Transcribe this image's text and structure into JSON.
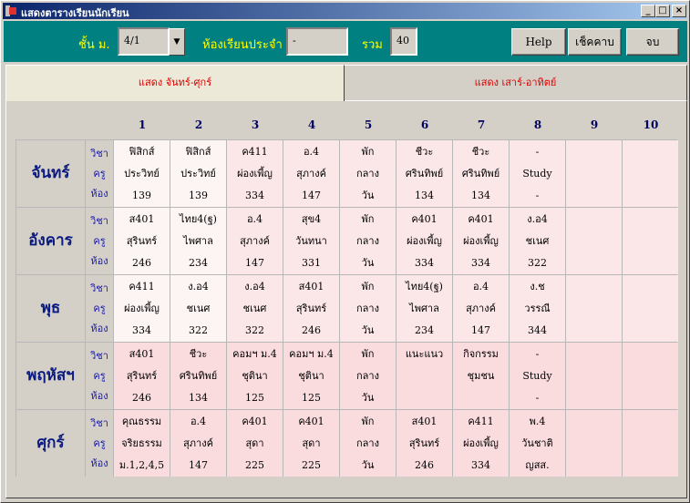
{
  "window": {
    "title": "แสดงตารางเรียนนักเรียน"
  },
  "toolbar": {
    "class_label": "ชั้น ม.",
    "class_value": "4/1",
    "homeroom_label": "ห้องเรียนประจำ",
    "homeroom_value": "-",
    "total_label": "รวม",
    "total_value": "40",
    "help_label": "Help",
    "check_label": "เช็คคาบ",
    "end_label": "จบ"
  },
  "tabs": [
    {
      "label": "แสดง จันทร์-ศุกร์",
      "active": true
    },
    {
      "label": "แสดง เสาร์-อาทิตย์",
      "active": false
    }
  ],
  "periods": [
    "1",
    "2",
    "3",
    "4",
    "5",
    "6",
    "7",
    "8",
    "9",
    "10"
  ],
  "row_labels": [
    "วิชา",
    "ครู",
    "ห้อง"
  ],
  "days": [
    {
      "name": "จันทร์",
      "cells": [
        [
          "ฟิสิกส์",
          "ประวิทย์",
          "139"
        ],
        [
          "ฟิสิกส์",
          "ประวิทย์",
          "139"
        ],
        [
          "ค411",
          "ผ่องเพี้ญ",
          "334"
        ],
        [
          "อ.4",
          "สุภางค์",
          "147"
        ],
        [
          "พัก",
          "กลาง",
          "วัน"
        ],
        [
          "ชีวะ",
          "ศรินทิพย์",
          "134"
        ],
        [
          "ชีวะ",
          "ศรินทิพย์",
          "134"
        ],
        [
          "-",
          "Study",
          "-"
        ],
        [
          "",
          "",
          ""
        ],
        [
          "",
          "",
          ""
        ]
      ]
    },
    {
      "name": "อังคาร",
      "cells": [
        [
          "ส401",
          "สุรินทร์",
          "246"
        ],
        [
          "ไทย4(ฐ)",
          "ไพศาล",
          "234"
        ],
        [
          "อ.4",
          "สุภางค์",
          "147"
        ],
        [
          "สุข4",
          "วันทนา",
          "331"
        ],
        [
          "พัก",
          "กลาง",
          "วัน"
        ],
        [
          "ค401",
          "ผ่องเพี้ญ",
          "334"
        ],
        [
          "ค401",
          "ผ่องเพี้ญ",
          "334"
        ],
        [
          "ง.อ4",
          "ชเนศ",
          "322"
        ],
        [
          "",
          "",
          ""
        ],
        [
          "",
          "",
          ""
        ]
      ]
    },
    {
      "name": "พุธ",
      "cells": [
        [
          "ค411",
          "ผ่องเพี้ญ",
          "334"
        ],
        [
          "ง.อ4",
          "ชเนศ",
          "322"
        ],
        [
          "ง.อ4",
          "ชเนศ",
          "322"
        ],
        [
          "ส401",
          "สุรินทร์",
          "246"
        ],
        [
          "พัก",
          "กลาง",
          "วัน"
        ],
        [
          "ไทย4(ฐ)",
          "ไพศาล",
          "234"
        ],
        [
          "อ.4",
          "สุภางค์",
          "147"
        ],
        [
          "ง.ช",
          "วรรณี",
          "344"
        ],
        [
          "",
          "",
          ""
        ],
        [
          "",
          "",
          ""
        ]
      ]
    },
    {
      "name": "พฤหัสฯ",
      "cells": [
        [
          "ส401",
          "สุรินทร์",
          "246"
        ],
        [
          "ชีวะ",
          "ศรินทิพย์",
          "134"
        ],
        [
          "คอมฯ ม.4",
          "ชุตินา",
          "125"
        ],
        [
          "คอมฯ ม.4",
          "ชุตินา",
          "125"
        ],
        [
          "พัก",
          "กลาง",
          "วัน"
        ],
        [
          "แนะแนว",
          "",
          ""
        ],
        [
          "กิจกรรม",
          "ชุมชน",
          ""
        ],
        [
          "-",
          "Study",
          "-"
        ],
        [
          "",
          "",
          ""
        ],
        [
          "",
          "",
          ""
        ]
      ]
    },
    {
      "name": "ศุกร์",
      "cells": [
        [
          "คุณธรรม",
          "จริยธรรม",
          "ม.1,2,4,5"
        ],
        [
          "อ.4",
          "สุภางค์",
          "147"
        ],
        [
          "ค401",
          "สุดา",
          "225"
        ],
        [
          "ค401",
          "สุดา",
          "225"
        ],
        [
          "พัก",
          "กลาง",
          "วัน"
        ],
        [
          "ส401",
          "สุรินทร์",
          "246"
        ],
        [
          "ค411",
          "ผ่องเพี้ญ",
          "334"
        ],
        [
          "พ.4",
          "วันชาติ",
          "ญสส."
        ],
        [
          "",
          "",
          ""
        ],
        [
          "",
          "",
          ""
        ]
      ]
    }
  ],
  "colors": {
    "cell_light": "#fdf4f4",
    "cell_mid": "#fbe6e8",
    "cell_pink": "#fadcdf",
    "title_gradient_start": "#0a246a",
    "toolbar_teal": "#008080"
  }
}
